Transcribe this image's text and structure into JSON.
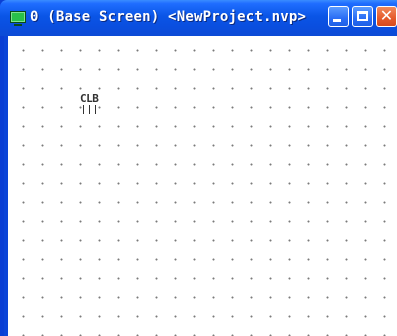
{
  "window": {
    "title": "0 (Base Screen) <NewProject.nvp>"
  },
  "titlebar": {
    "buttons": {
      "minimize_icon": "minimize-icon",
      "maximize_icon": "maximize-icon",
      "close_icon": "close-icon",
      "close_glyph": "✕"
    },
    "colors": {
      "titlebar": "#0a55e6",
      "close_button": "#e55a2b",
      "app_icon": "#29c14a"
    }
  },
  "canvas": {
    "grid": true,
    "component": {
      "label": "CLB",
      "icon": "clb-component-icon"
    }
  }
}
